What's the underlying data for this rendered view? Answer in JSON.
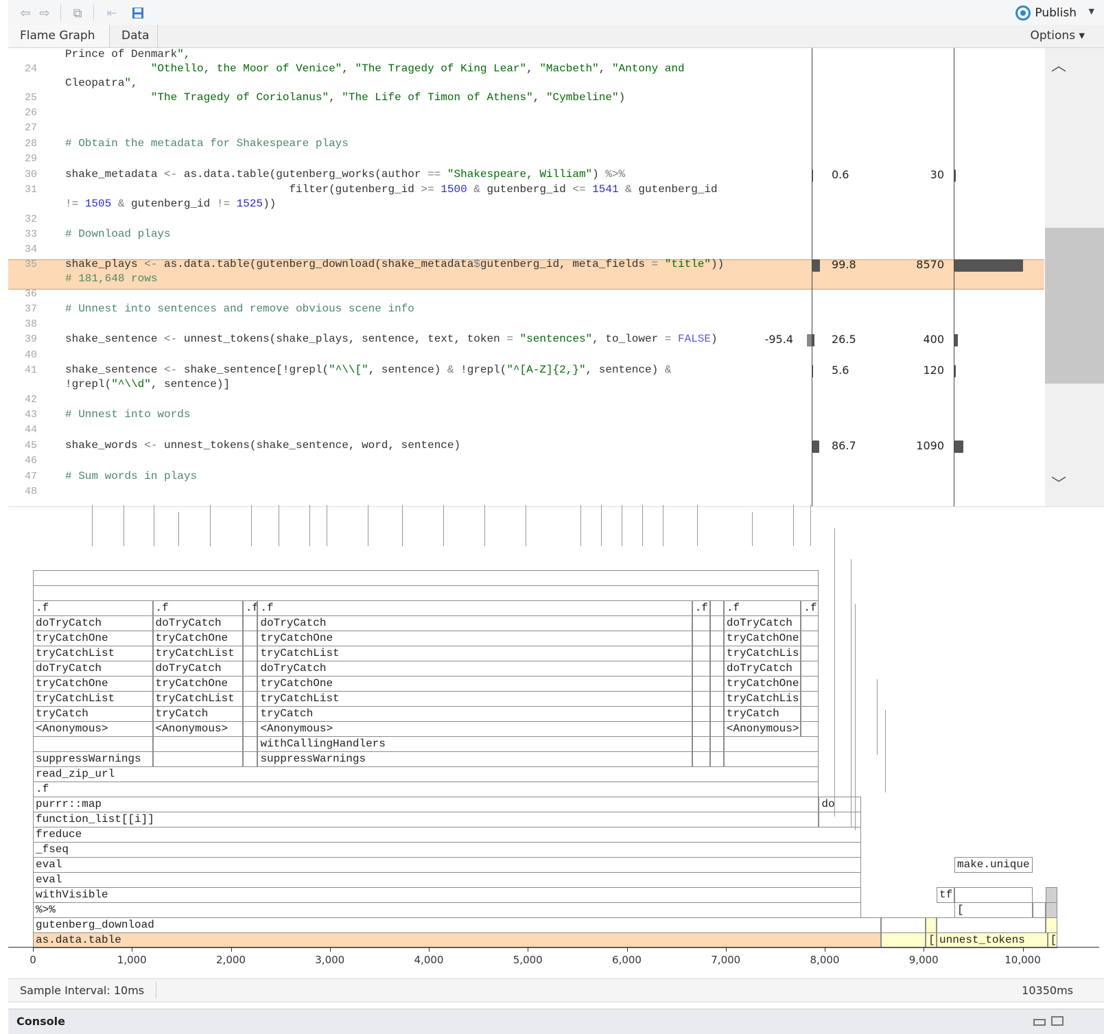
{
  "toolbar": {
    "back_icon": "back-arrow-icon",
    "forward_icon": "forward-arrow-icon",
    "show_in_window_icon": "popout-icon",
    "rewind_icon": "jump-back-icon",
    "save_icon": "save-disk-icon",
    "publish_label": "Publish"
  },
  "tabs": [
    {
      "label": "Flame Graph"
    },
    {
      "label": "Data"
    }
  ],
  "options_label": "Options ▾",
  "code": {
    "lines": [
      {
        "no": "",
        "text": "Prince of Denmark\","
      },
      {
        "no": "24",
        "text": "             \"Othello, the Moor of Venice\", \"The Tragedy of King Lear\", \"Macbeth\", \"Antony and"
      },
      {
        "no": "",
        "text": "Cleopatra\","
      },
      {
        "no": "25",
        "text": "             \"The Tragedy of Coriolanus\", \"The Life of Timon of Athens\", \"Cymbeline\")"
      },
      {
        "no": "26",
        "text": ""
      },
      {
        "no": "27",
        "text": ""
      },
      {
        "no": "28",
        "text": "# Obtain the metadata for Shakespeare plays"
      },
      {
        "no": "29",
        "text": ""
      },
      {
        "no": "30",
        "text": "shake_metadata <- as.data.table(gutenberg_works(author == \"Shakespeare, William\") %>%"
      },
      {
        "no": "31",
        "text": "                                  filter(gutenberg_id >= 1500 & gutenberg_id <= 1541 & gutenberg_id"
      },
      {
        "no": "",
        "text": "!= 1505 & gutenberg_id != 1525))"
      },
      {
        "no": "32",
        "text": ""
      },
      {
        "no": "33",
        "text": "# Download plays"
      },
      {
        "no": "34",
        "text": ""
      },
      {
        "no": "35",
        "text": "shake_plays <- as.data.table(gutenberg_download(shake_metadata$gutenberg_id, meta_fields = \"title\"))"
      },
      {
        "no": "",
        "text": "# 181,648 rows"
      },
      {
        "no": "36",
        "text": ""
      },
      {
        "no": "37",
        "text": "# Unnest into sentences and remove obvious scene info"
      },
      {
        "no": "38",
        "text": ""
      },
      {
        "no": "39",
        "text": "shake_sentence <- unnest_tokens(shake_plays, sentence, text, token = \"sentences\", to_lower = FALSE)"
      },
      {
        "no": "40",
        "text": ""
      },
      {
        "no": "41",
        "text": "shake_sentence <- shake_sentence[!grepl(\"^\\\\[\", sentence) & !grepl(\"^[A-Z]{2,}\", sentence) &"
      },
      {
        "no": "",
        "text": "!grepl(\"^\\\\d\", sentence)]"
      },
      {
        "no": "42",
        "text": ""
      },
      {
        "no": "43",
        "text": "# Unnest into words"
      },
      {
        "no": "44",
        "text": ""
      },
      {
        "no": "45",
        "text": "shake_words <- unnest_tokens(shake_sentence, word, sentence)"
      },
      {
        "no": "46",
        "text": ""
      },
      {
        "no": "47",
        "text": "# Sum words in plays"
      },
      {
        "no": "48",
        "text": ""
      }
    ],
    "metrics": [
      {
        "line": "30",
        "mem_freed": "",
        "mem_alloc": "0.6",
        "time": "30",
        "alloc_frac": 0.007,
        "time_frac": 0.0035
      },
      {
        "line": "35",
        "mem_freed": "",
        "mem_alloc": "99.8",
        "time": "8570",
        "alloc_frac": 1.0,
        "time_frac": 1.0
      },
      {
        "line": "39",
        "mem_freed": "-95.4",
        "mem_alloc": "26.5",
        "time": "400",
        "alloc_frac": 0.27,
        "time_frac": 0.047
      },
      {
        "line": "41",
        "mem_freed": "",
        "mem_alloc": "5.6",
        "time": "120",
        "alloc_frac": 0.06,
        "time_frac": 0.014
      },
      {
        "line": "45",
        "mem_freed": "",
        "mem_alloc": "86.7",
        "time": "1090",
        "alloc_frac": 0.87,
        "time_frac": 0.127
      }
    ]
  },
  "flame": {
    "x_max_ms": 10350,
    "frames": [
      {
        "label": "as.data.table",
        "depth": 0,
        "start": 0,
        "end": 8570,
        "style": "hi"
      },
      {
        "label": "",
        "depth": 0,
        "start": 8570,
        "end": 9020,
        "style": "ye"
      },
      {
        "label": "[",
        "depth": 0,
        "start": 9020,
        "end": 9130,
        "style": "ye"
      },
      {
        "label": "unnest_tokens",
        "depth": 0,
        "start": 9130,
        "end": 10250,
        "style": "ye"
      },
      {
        "label": "[",
        "depth": 0,
        "start": 10250,
        "end": 10350,
        "style": "ye"
      },
      {
        "label": "gutenberg_download",
        "depth": 1,
        "start": 0,
        "end": 8570,
        "style": ""
      },
      {
        "label": "",
        "depth": 1,
        "start": 8570,
        "end": 9020,
        "style": ""
      },
      {
        "label": "",
        "depth": 1,
        "start": 9020,
        "end": 9130,
        "style": "ye"
      },
      {
        "label": "",
        "depth": 1,
        "start": 9130,
        "end": 10230,
        "style": ""
      },
      {
        "label": "",
        "depth": 1,
        "start": 10230,
        "end": 10350,
        "style": "ye"
      },
      {
        "label": "%>%",
        "depth": 2,
        "start": 0,
        "end": 8370,
        "style": ""
      },
      {
        "label": "[",
        "depth": 2,
        "start": 9310,
        "end": 10100,
        "style": ""
      },
      {
        "label": "",
        "depth": 2,
        "start": 10100,
        "end": 10230,
        "style": ""
      },
      {
        "label": "",
        "depth": 2,
        "start": 10230,
        "end": 10350,
        "style": "gr"
      },
      {
        "label": "withVisible",
        "depth": 3,
        "start": 0,
        "end": 8370,
        "style": ""
      },
      {
        "label": "tf",
        "depth": 3,
        "start": 9130,
        "end": 9310,
        "style": ""
      },
      {
        "label": "",
        "depth": 3,
        "start": 9310,
        "end": 10100,
        "style": ""
      },
      {
        "label": "",
        "depth": 3,
        "start": 10230,
        "end": 10350,
        "style": "gr"
      },
      {
        "label": "eval",
        "depth": 4,
        "start": 0,
        "end": 8370,
        "style": ""
      },
      {
        "label": "eval",
        "depth": 5,
        "start": 0,
        "end": 8370,
        "style": ""
      },
      {
        "label": "make.unique",
        "depth": 5,
        "start": 9310,
        "end": 10100,
        "style": ""
      },
      {
        "label": "_fseq",
        "depth": 6,
        "start": 0,
        "end": 8370,
        "style": ""
      },
      {
        "label": "freduce",
        "depth": 7,
        "start": 0,
        "end": 8370,
        "style": ""
      },
      {
        "label": "function_list[[i]]",
        "depth": 8,
        "start": 0,
        "end": 7940,
        "style": ""
      },
      {
        "label": "",
        "depth": 8,
        "start": 7940,
        "end": 8370,
        "style": ""
      },
      {
        "label": "purrr::map",
        "depth": 9,
        "start": 0,
        "end": 7940,
        "style": ""
      },
      {
        "label": "do",
        "depth": 9,
        "start": 7940,
        "end": 8370,
        "style": ""
      },
      {
        "label": ".f",
        "depth": 10,
        "start": 0,
        "end": 7940,
        "style": ""
      },
      {
        "label": "read_zip_url",
        "depth": 11,
        "start": 0,
        "end": 7940,
        "style": ""
      },
      {
        "label": "suppressWarnings",
        "depth": 12,
        "start": 0,
        "end": 1210,
        "style": ""
      },
      {
        "label": "",
        "depth": 12,
        "start": 1210,
        "end": 2120,
        "style": ""
      },
      {
        "label": "",
        "depth": 12,
        "start": 2120,
        "end": 2270,
        "style": ""
      },
      {
        "label": "suppressWarnings",
        "depth": 12,
        "start": 2270,
        "end": 6660,
        "style": ""
      },
      {
        "label": "",
        "depth": 12,
        "start": 6660,
        "end": 6840,
        "style": ""
      },
      {
        "label": "",
        "depth": 12,
        "start": 6840,
        "end": 6980,
        "style": ""
      },
      {
        "label": "",
        "depth": 12,
        "start": 6980,
        "end": 7940,
        "style": ""
      },
      {
        "label": "",
        "depth": 13,
        "start": 0,
        "end": 1210,
        "style": ""
      },
      {
        "label": "",
        "depth": 13,
        "start": 1210,
        "end": 2120,
        "style": ""
      },
      {
        "label": "",
        "depth": 13,
        "start": 2120,
        "end": 2270,
        "style": ""
      },
      {
        "label": "withCallingHandlers",
        "depth": 13,
        "start": 2270,
        "end": 6660,
        "style": ""
      },
      {
        "label": "",
        "depth": 13,
        "start": 6660,
        "end": 6840,
        "style": ""
      },
      {
        "label": "",
        "depth": 13,
        "start": 6840,
        "end": 6980,
        "style": ""
      },
      {
        "label": "",
        "depth": 13,
        "start": 6980,
        "end": 7940,
        "style": ""
      },
      {
        "label": "<Anonymous>",
        "depth": 14,
        "start": 0,
        "end": 1210,
        "style": ""
      },
      {
        "label": "<Anonymous>",
        "depth": 14,
        "start": 1210,
        "end": 2120,
        "style": ""
      },
      {
        "label": "",
        "depth": 14,
        "start": 2120,
        "end": 2270,
        "style": ""
      },
      {
        "label": "<Anonymous>",
        "depth": 14,
        "start": 2270,
        "end": 6660,
        "style": ""
      },
      {
        "label": "",
        "depth": 14,
        "start": 6660,
        "end": 6840,
        "style": ""
      },
      {
        "label": "",
        "depth": 14,
        "start": 6840,
        "end": 6980,
        "style": ""
      },
      {
        "label": "<Anonymous>",
        "depth": 14,
        "start": 6980,
        "end": 7760,
        "style": ""
      },
      {
        "label": "",
        "depth": 14,
        "start": 7760,
        "end": 7940,
        "style": ""
      },
      {
        "label": "tryCatch",
        "depth": 15,
        "start": 0,
        "end": 1210,
        "style": ""
      },
      {
        "label": "tryCatch",
        "depth": 15,
        "start": 1210,
        "end": 2120,
        "style": ""
      },
      {
        "label": "",
        "depth": 15,
        "start": 2120,
        "end": 2270,
        "style": ""
      },
      {
        "label": "tryCatch",
        "depth": 15,
        "start": 2270,
        "end": 6660,
        "style": ""
      },
      {
        "label": "",
        "depth": 15,
        "start": 6660,
        "end": 6840,
        "style": ""
      },
      {
        "label": "",
        "depth": 15,
        "start": 6840,
        "end": 6980,
        "style": ""
      },
      {
        "label": "tryCatch",
        "depth": 15,
        "start": 6980,
        "end": 7760,
        "style": ""
      },
      {
        "label": "",
        "depth": 15,
        "start": 7760,
        "end": 7940,
        "style": ""
      },
      {
        "label": "tryCatchList",
        "depth": 16,
        "start": 0,
        "end": 1210,
        "style": ""
      },
      {
        "label": "tryCatchList",
        "depth": 16,
        "start": 1210,
        "end": 2120,
        "style": ""
      },
      {
        "label": "",
        "depth": 16,
        "start": 2120,
        "end": 2270,
        "style": ""
      },
      {
        "label": "tryCatchList",
        "depth": 16,
        "start": 2270,
        "end": 6660,
        "style": ""
      },
      {
        "label": "",
        "depth": 16,
        "start": 6660,
        "end": 6840,
        "style": ""
      },
      {
        "label": "",
        "depth": 16,
        "start": 6840,
        "end": 6980,
        "style": ""
      },
      {
        "label": "tryCatchList",
        "depth": 16,
        "start": 6980,
        "end": 7760,
        "style": ""
      },
      {
        "label": "",
        "depth": 16,
        "start": 7760,
        "end": 7940,
        "style": ""
      },
      {
        "label": "tryCatchOne",
        "depth": 17,
        "start": 0,
        "end": 1210,
        "style": ""
      },
      {
        "label": "tryCatchOne",
        "depth": 17,
        "start": 1210,
        "end": 2120,
        "style": ""
      },
      {
        "label": "",
        "depth": 17,
        "start": 2120,
        "end": 2270,
        "style": ""
      },
      {
        "label": "tryCatchOne",
        "depth": 17,
        "start": 2270,
        "end": 6660,
        "style": ""
      },
      {
        "label": "",
        "depth": 17,
        "start": 6660,
        "end": 6840,
        "style": ""
      },
      {
        "label": "",
        "depth": 17,
        "start": 6840,
        "end": 6980,
        "style": ""
      },
      {
        "label": "tryCatchOne",
        "depth": 17,
        "start": 6980,
        "end": 7760,
        "style": ""
      },
      {
        "label": "",
        "depth": 17,
        "start": 7760,
        "end": 7940,
        "style": ""
      },
      {
        "label": "doTryCatch",
        "depth": 18,
        "start": 0,
        "end": 1210,
        "style": ""
      },
      {
        "label": "doTryCatch",
        "depth": 18,
        "start": 1210,
        "end": 2120,
        "style": ""
      },
      {
        "label": "",
        "depth": 18,
        "start": 2120,
        "end": 2270,
        "style": ""
      },
      {
        "label": "doTryCatch",
        "depth": 18,
        "start": 2270,
        "end": 6660,
        "style": ""
      },
      {
        "label": "",
        "depth": 18,
        "start": 6660,
        "end": 6840,
        "style": ""
      },
      {
        "label": "",
        "depth": 18,
        "start": 6840,
        "end": 6980,
        "style": ""
      },
      {
        "label": "doTryCatch",
        "depth": 18,
        "start": 6980,
        "end": 7760,
        "style": ""
      },
      {
        "label": "",
        "depth": 18,
        "start": 7760,
        "end": 7940,
        "style": ""
      },
      {
        "label": "tryCatchList",
        "depth": 19,
        "start": 0,
        "end": 1210,
        "style": ""
      },
      {
        "label": "tryCatchList",
        "depth": 19,
        "start": 1210,
        "end": 2120,
        "style": ""
      },
      {
        "label": "",
        "depth": 19,
        "start": 2120,
        "end": 2270,
        "style": ""
      },
      {
        "label": "tryCatchList",
        "depth": 19,
        "start": 2270,
        "end": 6660,
        "style": ""
      },
      {
        "label": "",
        "depth": 19,
        "start": 6660,
        "end": 6840,
        "style": ""
      },
      {
        "label": "",
        "depth": 19,
        "start": 6840,
        "end": 6980,
        "style": ""
      },
      {
        "label": "tryCatchList",
        "depth": 19,
        "start": 6980,
        "end": 7760,
        "style": ""
      },
      {
        "label": "",
        "depth": 19,
        "start": 7760,
        "end": 7940,
        "style": ""
      },
      {
        "label": "tryCatchOne",
        "depth": 20,
        "start": 0,
        "end": 1210,
        "style": ""
      },
      {
        "label": "tryCatchOne",
        "depth": 20,
        "start": 1210,
        "end": 2120,
        "style": ""
      },
      {
        "label": "",
        "depth": 20,
        "start": 2120,
        "end": 2270,
        "style": ""
      },
      {
        "label": "tryCatchOne",
        "depth": 20,
        "start": 2270,
        "end": 6660,
        "style": ""
      },
      {
        "label": "",
        "depth": 20,
        "start": 6660,
        "end": 6840,
        "style": ""
      },
      {
        "label": "",
        "depth": 20,
        "start": 6840,
        "end": 6980,
        "style": ""
      },
      {
        "label": "tryCatchOne",
        "depth": 20,
        "start": 6980,
        "end": 7760,
        "style": ""
      },
      {
        "label": "",
        "depth": 20,
        "start": 7760,
        "end": 7940,
        "style": ""
      },
      {
        "label": "doTryCatch",
        "depth": 21,
        "start": 0,
        "end": 1210,
        "style": ""
      },
      {
        "label": "doTryCatch",
        "depth": 21,
        "start": 1210,
        "end": 2120,
        "style": ""
      },
      {
        "label": "",
        "depth": 21,
        "start": 2120,
        "end": 2270,
        "style": ""
      },
      {
        "label": "doTryCatch",
        "depth": 21,
        "start": 2270,
        "end": 6660,
        "style": ""
      },
      {
        "label": "",
        "depth": 21,
        "start": 6660,
        "end": 6840,
        "style": ""
      },
      {
        "label": "",
        "depth": 21,
        "start": 6840,
        "end": 6980,
        "style": ""
      },
      {
        "label": "doTryCatch",
        "depth": 21,
        "start": 6980,
        "end": 7760,
        "style": ""
      },
      {
        "label": "",
        "depth": 21,
        "start": 7760,
        "end": 7940,
        "style": ""
      },
      {
        "label": ".f",
        "depth": 22,
        "start": 0,
        "end": 1210,
        "style": ""
      },
      {
        "label": ".f",
        "depth": 22,
        "start": 1210,
        "end": 2120,
        "style": ""
      },
      {
        "label": ".f",
        "depth": 22,
        "start": 2120,
        "end": 2270,
        "style": ""
      },
      {
        "label": ".f",
        "depth": 22,
        "start": 2270,
        "end": 6660,
        "style": ""
      },
      {
        "label": ".f",
        "depth": 22,
        "start": 6660,
        "end": 6840,
        "style": ""
      },
      {
        "label": "",
        "depth": 22,
        "start": 6840,
        "end": 6980,
        "style": ""
      },
      {
        "label": ".f",
        "depth": 22,
        "start": 6980,
        "end": 7760,
        "style": ""
      },
      {
        "label": ".f",
        "depth": 22,
        "start": 7760,
        "end": 7940,
        "style": ""
      },
      {
        "label": "",
        "depth": 23,
        "start": 0,
        "end": 7940,
        "style": ""
      },
      {
        "label": "",
        "depth": 24,
        "start": 0,
        "end": 7940,
        "style": ""
      }
    ],
    "axis_ticks": [
      "0",
      "1,000",
      "2,000",
      "3,000",
      "4,000",
      "5,000",
      "6,000",
      "7,000",
      "8,000",
      "9,000",
      "10,000"
    ]
  },
  "status": {
    "sample_interval": "Sample Interval: 10ms",
    "total": "10350ms"
  },
  "console": {
    "label": "Console",
    "minimize_icon": "minimize-window-icon",
    "maximize_icon": "maximize-window-icon"
  }
}
